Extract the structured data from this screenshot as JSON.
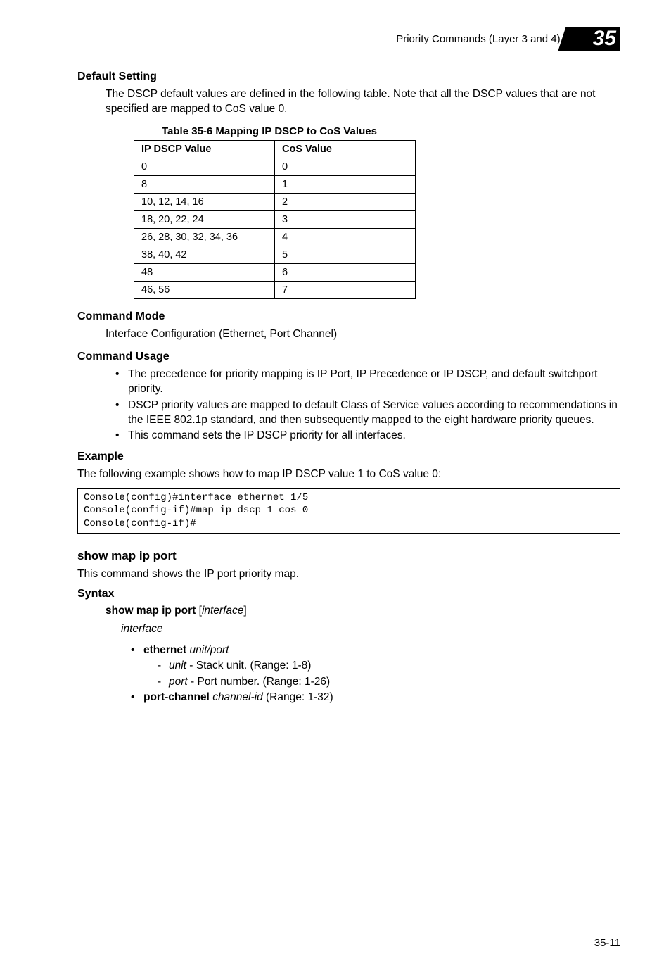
{
  "header": {
    "breadcrumb": "Priority Commands (Layer 3 and 4)",
    "chapter": "35"
  },
  "defaultSetting": {
    "heading": "Default Setting",
    "body": "The DSCP default values are defined in the following table. Note that all the DSCP values that are not specified are mapped to CoS value 0."
  },
  "table": {
    "caption": "Table 35-6   Mapping IP DSCP to CoS Values",
    "headers": [
      "IP DSCP Value",
      "CoS Value"
    ],
    "rows": [
      [
        "0",
        "0"
      ],
      [
        "8",
        "1"
      ],
      [
        "10, 12, 14, 16",
        "2"
      ],
      [
        "18, 20, 22, 24",
        "3"
      ],
      [
        "26, 28, 30, 32, 34, 36",
        "4"
      ],
      [
        "38, 40, 42",
        "5"
      ],
      [
        "48",
        "6"
      ],
      [
        "46, 56",
        "7"
      ]
    ]
  },
  "commandMode": {
    "heading": "Command Mode",
    "body": "Interface Configuration (Ethernet, Port Channel)"
  },
  "commandUsage": {
    "heading": "Command Usage",
    "bullets": [
      "The precedence for priority mapping is IP Port, IP Precedence or IP DSCP, and default switchport priority.",
      "DSCP priority values are mapped to default Class of Service values according to recommendations in the IEEE 802.1p standard, and then subsequently mapped to the eight hardware priority queues.",
      "This command sets the IP DSCP priority for all interfaces."
    ]
  },
  "example": {
    "heading": "Example",
    "intro": "The following example shows how to map IP DSCP value 1 to CoS value 0:",
    "code": "Console(config)#interface ethernet 1/5\nConsole(config-if)#map ip dscp 1 cos 0\nConsole(config-if)#"
  },
  "showCmd": {
    "name": "show map ip port",
    "desc": "This command shows the IP port priority map.",
    "syntaxHeading": "Syntax",
    "syntaxBold": "show map ip port",
    "syntaxArg": "interface",
    "interfaceLabel": "interface",
    "ethernet": {
      "bold": "ethernet",
      "ital": "unit/port",
      "unitItal": "unit",
      "unitRest": " - Stack unit. (Range: 1-8)",
      "portItal": "port",
      "portRest": " - Port number. (Range: 1-26)"
    },
    "portchannel": {
      "bold": "port-channel",
      "ital": "channel-id",
      "rest": " (Range: 1-32)"
    }
  },
  "pageNumber": "35-11"
}
